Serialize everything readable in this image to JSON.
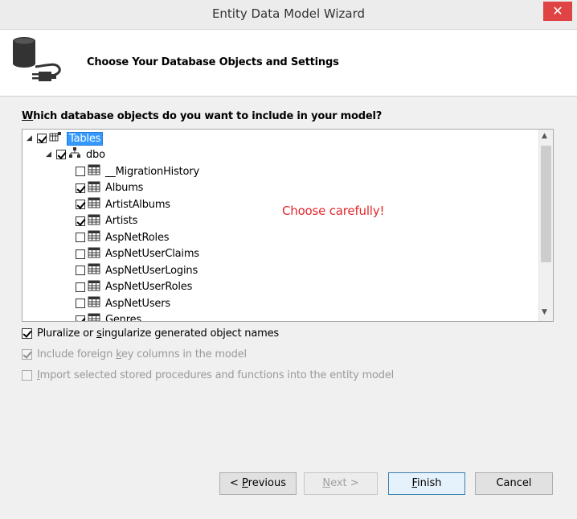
{
  "window": {
    "title": "Entity Data Model Wizard",
    "close_glyph": "✕"
  },
  "header": {
    "title": "Choose Your Database Objects and Settings",
    "icon": "database-connector-icon"
  },
  "tree": {
    "question_prefix": "W",
    "question_rest": "hich database objects do you want to include in your model?",
    "root": {
      "label": "Tables",
      "checked": true,
      "selected": true,
      "expanded": true
    },
    "schema": {
      "label": "dbo",
      "checked": true,
      "expanded": true
    },
    "items": [
      {
        "label": "__MigrationHistory",
        "checked": false
      },
      {
        "label": "Albums",
        "checked": true
      },
      {
        "label": "ArtistAlbums",
        "checked": true
      },
      {
        "label": "Artists",
        "checked": true
      },
      {
        "label": "AspNetRoles",
        "checked": false
      },
      {
        "label": "AspNetUserClaims",
        "checked": false
      },
      {
        "label": "AspNetUserLogins",
        "checked": false
      },
      {
        "label": "AspNetUserRoles",
        "checked": false
      },
      {
        "label": "AspNetUsers",
        "checked": false
      },
      {
        "label": "Genres",
        "checked": true
      }
    ]
  },
  "annotation": "Choose carefully!",
  "options": {
    "pluralize": {
      "pre": "Pluralize or ",
      "key": "s",
      "post": "ingularize generated object names",
      "checked": true,
      "enabled": true
    },
    "foreign_keys": {
      "pre": "Include foreign ",
      "key": "k",
      "post": "ey columns in the model",
      "checked": true,
      "enabled": false
    },
    "stored_procs": {
      "pre": "",
      "key": "I",
      "post": "mport selected stored procedures and functions into the entity model",
      "checked": false,
      "enabled": false
    }
  },
  "buttons": {
    "previous": {
      "pre": "< ",
      "key": "P",
      "post": "revious"
    },
    "next": {
      "pre": "",
      "key": "N",
      "post": "ext >"
    },
    "finish": {
      "pre": "",
      "key": "F",
      "post": "inish"
    },
    "cancel": {
      "label": "Cancel"
    }
  }
}
